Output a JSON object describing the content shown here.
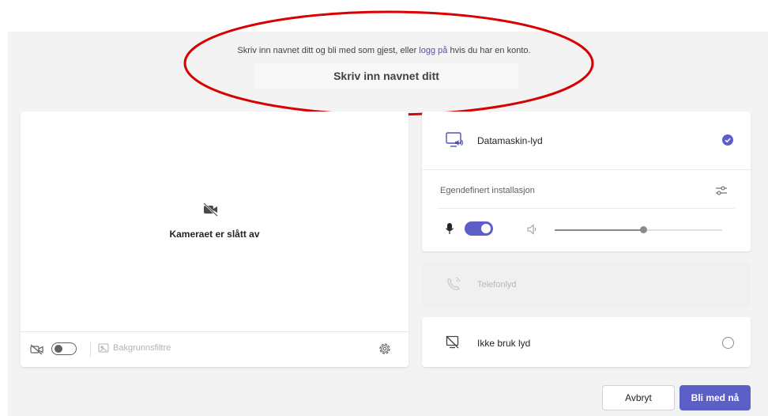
{
  "join": {
    "prompt_before": "Skriv inn navnet ditt og bli med som gjest, eller ",
    "login_link": "logg på",
    "prompt_after": " hvis du har en konto.",
    "name_placeholder": "Skriv inn navnet ditt",
    "name_value": ""
  },
  "camera": {
    "status": "Kameraet er slått av",
    "camera_on": false,
    "background_filters": "Bakgrunnsfiltre"
  },
  "audio": {
    "computer_audio": "Datamaskin-lyd",
    "custom_setup": "Egendefinert installasjon",
    "mic_on": true,
    "volume_level": 0.52,
    "phone_audio": "Telefonlyd",
    "no_audio": "Ikke bruk lyd",
    "selected": "computer_audio"
  },
  "actions": {
    "cancel": "Avbryt",
    "join_now": "Bli med nå"
  },
  "colors": {
    "accent": "#5b5fc7",
    "annotation": "#d80000"
  }
}
